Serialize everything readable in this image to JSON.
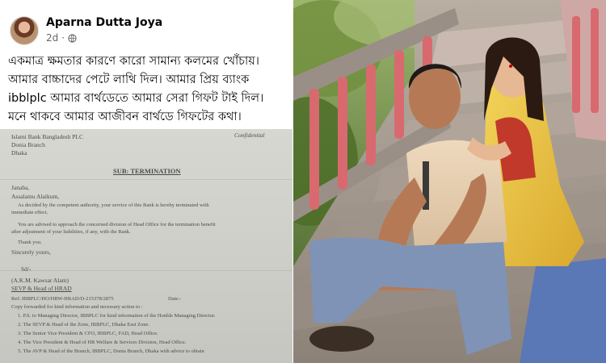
{
  "post": {
    "author": "Aparna Dutta Joya",
    "time": "2d",
    "separator": "·",
    "privacy_icon": "globe-icon",
    "text_lines": [
      "একমাত্র ক্ষমতার কারণে কারো সামান্য কলমের খোঁচায়।",
      "আমার বাচ্চাদের পেটে লাথি দিল। আমার প্রিয় ব্যাংক",
      "ibblplc আমার বার্থডেতে আমার সেরা গিফট টাই দিল।",
      "মনে থাকবে আমার আজীবন বার্থডে গিফটের কথা।"
    ]
  },
  "letter": {
    "org": "Islami Bank Bangladesh PLC",
    "branch": "Donia Branch",
    "city": "Dhaka",
    "confidential": "Confidential",
    "subject": "SUB: TERMINATION",
    "salutation": "Janaba,",
    "greeting": "Assalamu Alaikum,",
    "body_lines": [
      "As decided by the competent authority, your service of this Bank is hereby terminated with",
      "immediate effect.",
      "You are advised to approach the concerned division of Head Office for the termination benefit",
      "after adjustment of your liabilities, if any, with the Bank."
    ],
    "thanks": "Thank you.",
    "closing": "Sincerely yours,",
    "sd": "Sd/-",
    "signatory": "(A.K.M. Kawsar Alam)",
    "designation": "SEVP & Head of HRAD",
    "ref": "Ref: IBBPLC/HO/HRW-HRAD/D-215378/2875",
    "ref_date": "Date:-",
    "copy_header": "Copy forwarded for kind information and necessary action to :",
    "copy_list": [
      "1. P.S. to Managing Director, IBBPLC for kind information of the Honble Managing Director.",
      "2. The SEVP & Head of the Zone, IBBPLC, Dhaka East Zone.",
      "3. The Senior Vice President & CFO, IBBPLC, FAD, Head Office.",
      "4. The Vice President & Head of HR Welfare & Services Division, Head Office.",
      "5. The AVP & Head of the Branch, IBBPLC, Donia Branch, Dhaka with advice to obtain"
    ]
  }
}
